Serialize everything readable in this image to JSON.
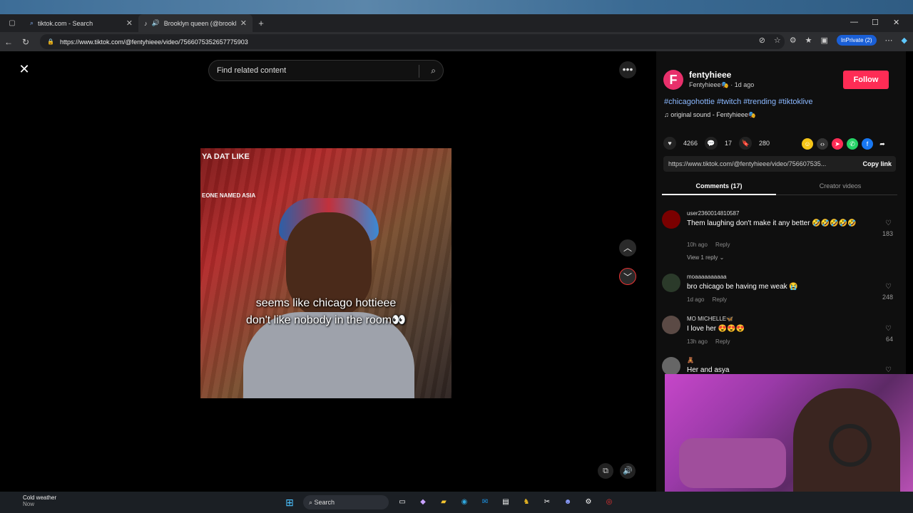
{
  "browser": {
    "tabs": [
      {
        "title": "tiktok.com - Search"
      },
      {
        "title": "Brooklyn queen (@brooklyn..."
      }
    ],
    "url": "https://www.tiktok.com/@fentyhieee/video/7566075352657775903",
    "inprivate_label": "InPrivate (2)"
  },
  "video_page": {
    "search_placeholder": "Find related content",
    "overlay_top": "YA DAT LIKE",
    "overlay_sub": "EONE NAMED ASIA",
    "caption_line1": "seems like chicago hottieee",
    "caption_line2": "don't like nobody in the room👀"
  },
  "creator": {
    "avatar_letter": "F",
    "username": "fentyhieee",
    "display_line": "Fentyhieee🎭 · 1d ago",
    "follow_label": "Follow",
    "hashtags": "#chicagohottie #twitch #trending #tiktoklive",
    "sound": "original sound - Fentyhieee🎭"
  },
  "stats": {
    "likes": "4266",
    "comments": "17",
    "saves": "280"
  },
  "share": {
    "link_text": "https://www.tiktok.com/@fentyhieee/video/756607535...",
    "copy_label": "Copy link"
  },
  "tabs": {
    "comments_label": "Comments (17)",
    "creator_label": "Creator videos"
  },
  "comments": [
    {
      "user": "user2360014810587",
      "text": "Them laughing don't make it any better 🤣🤣🤣🤣🤣",
      "time": "10h ago",
      "reply": "Reply",
      "likes": "183",
      "view_replies": "View 1 reply",
      "avatar_color": "#7a0000"
    },
    {
      "user": "moaaaaaaaaaa",
      "text": "bro chicago be having me weak 😭",
      "time": "1d ago",
      "reply": "Reply",
      "likes": "248",
      "avatar_color": "#2b3a2a"
    },
    {
      "user": "MO MICHELLE🦋",
      "text": "I love her 😍😍😍",
      "time": "13h ago",
      "reply": "Reply",
      "likes": "64",
      "avatar_color": "#5b4a45"
    },
    {
      "user": "🧸",
      "text": "Her and asya",
      "time": "",
      "reply": "",
      "likes": "",
      "avatar_color": "#666666"
    }
  ],
  "taskbar": {
    "weather_title": "Cold weather",
    "weather_sub": "Now",
    "search_label": "Search"
  },
  "colors": {
    "follow": "#fe2c55",
    "hashtag": "#8bb8ff",
    "avatar": "#e8306b"
  }
}
